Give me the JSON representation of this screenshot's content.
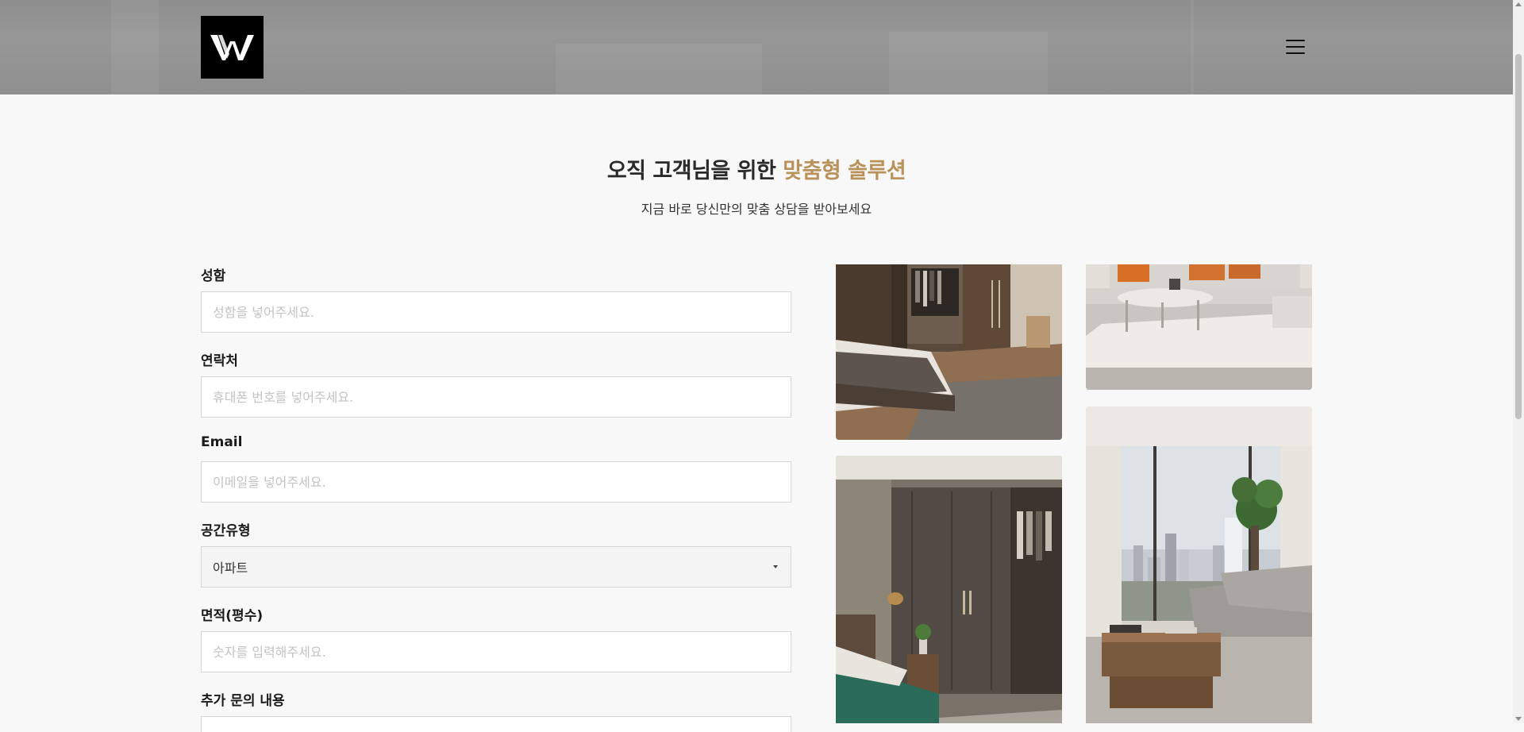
{
  "header": {
    "logo_text": "W",
    "menu_icon": "hamburger-menu-icon"
  },
  "hero": {
    "title_prefix": "오직 고객님을 위한 ",
    "title_accent": "맞춤형 솔루션",
    "subtitle": "지금 바로 당신만의 맞춤 상담을 받아보세요"
  },
  "form": {
    "name": {
      "label": "성함",
      "placeholder": "성함을 넣어주세요."
    },
    "phone": {
      "label": "연락처",
      "placeholder": "휴대폰 번호를 넣어주세요."
    },
    "email": {
      "label": "Email",
      "placeholder": "이메일을 넣어주세요."
    },
    "space_type": {
      "label": "공간유형",
      "value": "아파트"
    },
    "area": {
      "label": "면적(평수)",
      "placeholder": "숫자를 입력해주세요."
    },
    "inquiry": {
      "label": "추가 문의 내용"
    }
  },
  "colors": {
    "accent": "#b8925a",
    "header_bg": "#929292",
    "page_bg": "#f8f8f8"
  }
}
